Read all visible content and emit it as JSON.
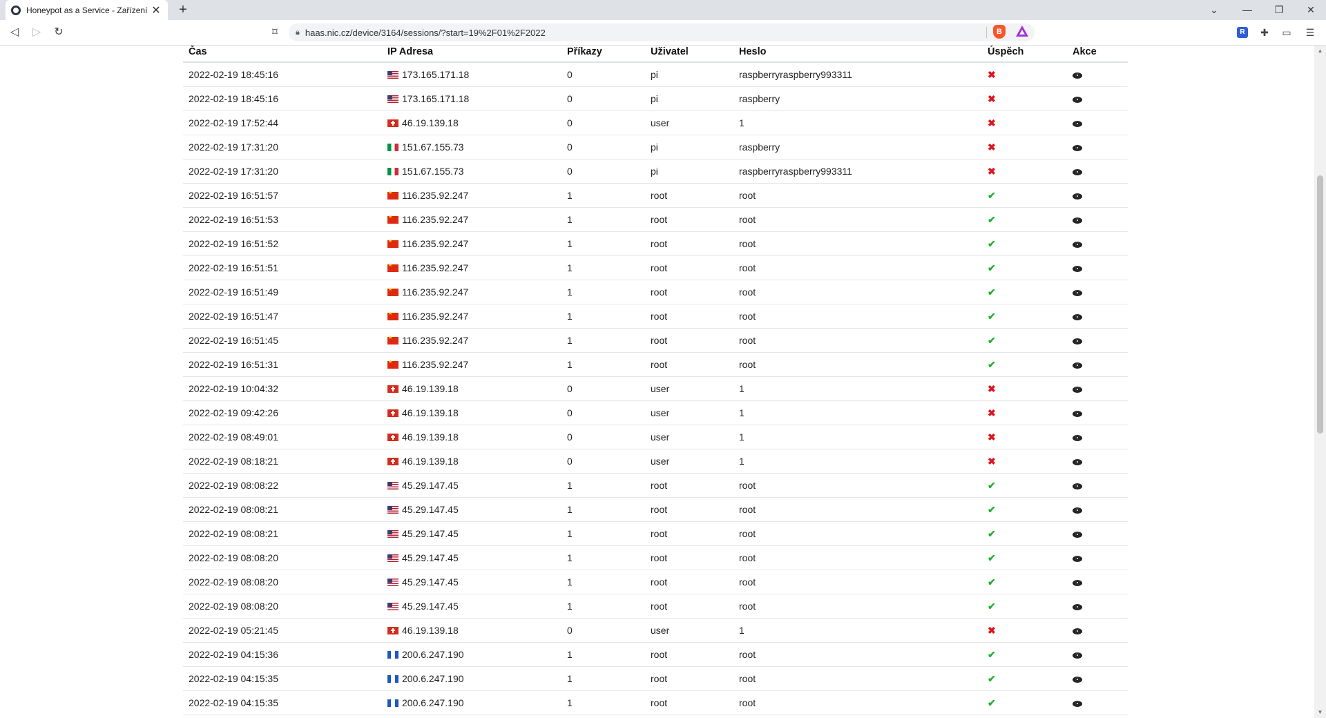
{
  "browser": {
    "tab_title": "Honeypot as a Service - Zařízení",
    "tab_close": "✕",
    "new_tab": "+",
    "url": "haas.nic.cz/device/3164/sessions/?start=19%2F01%2F2022",
    "window_controls": [
      "⌄",
      "—",
      "❐",
      "✕"
    ]
  },
  "table": {
    "headers": [
      "Čas",
      "IP Adresa",
      "Příkazy",
      "Uživatel",
      "Heslo",
      "Úspěch",
      "Akce"
    ],
    "rows": [
      {
        "time": "2022-02-19 18:45:16",
        "flag": "us",
        "ip": "173.165.171.18",
        "commands": "0",
        "user": "pi",
        "password": "raspberryraspberry993311",
        "success": false
      },
      {
        "time": "2022-02-19 18:45:16",
        "flag": "us",
        "ip": "173.165.171.18",
        "commands": "0",
        "user": "pi",
        "password": "raspberry",
        "success": false
      },
      {
        "time": "2022-02-19 17:52:44",
        "flag": "ch",
        "ip": "46.19.139.18",
        "commands": "0",
        "user": "user",
        "password": "1",
        "success": false
      },
      {
        "time": "2022-02-19 17:31:20",
        "flag": "it",
        "ip": "151.67.155.73",
        "commands": "0",
        "user": "pi",
        "password": "raspberry",
        "success": false
      },
      {
        "time": "2022-02-19 17:31:20",
        "flag": "it",
        "ip": "151.67.155.73",
        "commands": "0",
        "user": "pi",
        "password": "raspberryraspberry993311",
        "success": false
      },
      {
        "time": "2022-02-19 16:51:57",
        "flag": "cn",
        "ip": "116.235.92.247",
        "commands": "1",
        "user": "root",
        "password": "root",
        "success": true
      },
      {
        "time": "2022-02-19 16:51:53",
        "flag": "cn",
        "ip": "116.235.92.247",
        "commands": "1",
        "user": "root",
        "password": "root",
        "success": true
      },
      {
        "time": "2022-02-19 16:51:52",
        "flag": "cn",
        "ip": "116.235.92.247",
        "commands": "1",
        "user": "root",
        "password": "root",
        "success": true
      },
      {
        "time": "2022-02-19 16:51:51",
        "flag": "cn",
        "ip": "116.235.92.247",
        "commands": "1",
        "user": "root",
        "password": "root",
        "success": true
      },
      {
        "time": "2022-02-19 16:51:49",
        "flag": "cn",
        "ip": "116.235.92.247",
        "commands": "1",
        "user": "root",
        "password": "root",
        "success": true
      },
      {
        "time": "2022-02-19 16:51:47",
        "flag": "cn",
        "ip": "116.235.92.247",
        "commands": "1",
        "user": "root",
        "password": "root",
        "success": true
      },
      {
        "time": "2022-02-19 16:51:45",
        "flag": "cn",
        "ip": "116.235.92.247",
        "commands": "1",
        "user": "root",
        "password": "root",
        "success": true
      },
      {
        "time": "2022-02-19 16:51:31",
        "flag": "cn",
        "ip": "116.235.92.247",
        "commands": "1",
        "user": "root",
        "password": "root",
        "success": true
      },
      {
        "time": "2022-02-19 10:04:32",
        "flag": "ch",
        "ip": "46.19.139.18",
        "commands": "0",
        "user": "user",
        "password": "1",
        "success": false
      },
      {
        "time": "2022-02-19 09:42:26",
        "flag": "ch",
        "ip": "46.19.139.18",
        "commands": "0",
        "user": "user",
        "password": "1",
        "success": false
      },
      {
        "time": "2022-02-19 08:49:01",
        "flag": "ch",
        "ip": "46.19.139.18",
        "commands": "0",
        "user": "user",
        "password": "1",
        "success": false
      },
      {
        "time": "2022-02-19 08:18:21",
        "flag": "ch",
        "ip": "46.19.139.18",
        "commands": "0",
        "user": "user",
        "password": "1",
        "success": false
      },
      {
        "time": "2022-02-19 08:08:22",
        "flag": "us",
        "ip": "45.29.147.45",
        "commands": "1",
        "user": "root",
        "password": "root",
        "success": true
      },
      {
        "time": "2022-02-19 08:08:21",
        "flag": "us",
        "ip": "45.29.147.45",
        "commands": "1",
        "user": "root",
        "password": "root",
        "success": true
      },
      {
        "time": "2022-02-19 08:08:21",
        "flag": "us",
        "ip": "45.29.147.45",
        "commands": "1",
        "user": "root",
        "password": "root",
        "success": true
      },
      {
        "time": "2022-02-19 08:08:20",
        "flag": "us",
        "ip": "45.29.147.45",
        "commands": "1",
        "user": "root",
        "password": "root",
        "success": true
      },
      {
        "time": "2022-02-19 08:08:20",
        "flag": "us",
        "ip": "45.29.147.45",
        "commands": "1",
        "user": "root",
        "password": "root",
        "success": true
      },
      {
        "time": "2022-02-19 08:08:20",
        "flag": "us",
        "ip": "45.29.147.45",
        "commands": "1",
        "user": "root",
        "password": "root",
        "success": true
      },
      {
        "time": "2022-02-19 05:21:45",
        "flag": "ch",
        "ip": "46.19.139.18",
        "commands": "0",
        "user": "user",
        "password": "1",
        "success": false
      },
      {
        "time": "2022-02-19 04:15:36",
        "flag": "ar",
        "ip": "200.6.247.190",
        "commands": "1",
        "user": "root",
        "password": "root",
        "success": true
      },
      {
        "time": "2022-02-19 04:15:35",
        "flag": "ar",
        "ip": "200.6.247.190",
        "commands": "1",
        "user": "root",
        "password": "root",
        "success": true
      },
      {
        "time": "2022-02-19 04:15:35",
        "flag": "ar",
        "ip": "200.6.247.190",
        "commands": "1",
        "user": "root",
        "password": "root",
        "success": true
      }
    ]
  },
  "icons": {
    "success": "check-icon",
    "failure": "cross-icon",
    "action": "eye-icon"
  },
  "colors": {
    "success": "#23b02f",
    "failure": "#e0141e"
  }
}
